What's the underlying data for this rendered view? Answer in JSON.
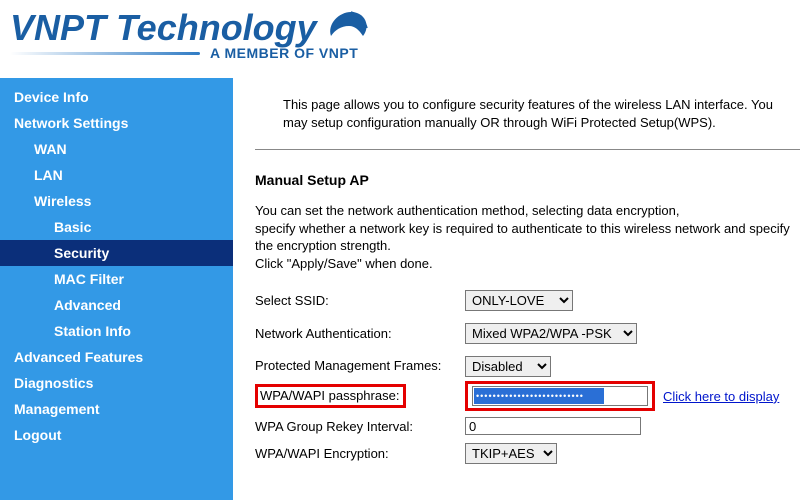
{
  "brand": {
    "name": "VNPT Technology",
    "sub": "A MEMBER OF VNPT"
  },
  "nav": {
    "device_info": "Device Info",
    "network_settings": "Network Settings",
    "wan": "WAN",
    "lan": "LAN",
    "wireless": "Wireless",
    "basic": "Basic",
    "security": "Security",
    "mac_filter": "MAC Filter",
    "advanced": "Advanced",
    "station_info": "Station Info",
    "advanced_features": "Advanced Features",
    "diagnostics": "Diagnostics",
    "management": "Management",
    "logout": "Logout"
  },
  "intro": "This page allows you to configure security features of the wireless LAN interface. You may setup configuration manually OR through WiFi Protected Setup(WPS).",
  "section": {
    "title": "Manual Setup AP",
    "desc": "You can set the network authentication method, selecting data encryption,\nspecify whether a network key is required to authenticate to this wireless network and specify the encryption strength.\nClick \"Apply/Save\" when done."
  },
  "form": {
    "ssid_label": "Select SSID:",
    "ssid_value": "ONLY-LOVE",
    "auth_label": "Network Authentication:",
    "auth_value": "Mixed WPA2/WPA -PSK",
    "pmf_label": "Protected Management Frames:",
    "pmf_value": "Disabled",
    "pass_label": "WPA/WAPI passphrase:",
    "pass_mask": "••••••••••••••••••••••••••",
    "pass_link": "Click here to display",
    "rekey_label": "WPA Group Rekey Interval:",
    "rekey_value": "0",
    "enc_label": "WPA/WAPI Encryption:",
    "enc_value": "TKIP+AES"
  }
}
